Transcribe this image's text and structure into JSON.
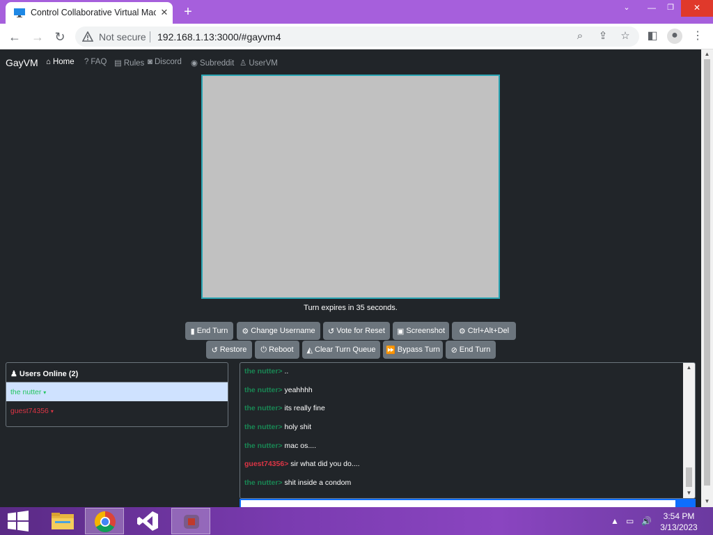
{
  "browser": {
    "tab_title": "Control Collaborative Virtual Mac",
    "not_secure": "Not secure",
    "url": "192.168.1.13:3000/#gayvm4"
  },
  "site": {
    "brand": "GayVM",
    "nav": [
      "Home",
      "FAQ",
      "Rules",
      "Discord",
      "Subreddit",
      "UserVM"
    ]
  },
  "turn_text": "Turn expires in 35 seconds.",
  "buttons_row1": [
    "End Turn",
    "Change Username",
    "Vote for Reset",
    "Screenshot",
    "Ctrl+Alt+Del"
  ],
  "buttons_row2": [
    "Restore",
    "Reboot",
    "Clear Turn Queue",
    "Bypass Turn",
    "End Turn"
  ],
  "users": {
    "header": "Users Online (2)",
    "list": [
      {
        "name": "the nutter",
        "color": "#22c55e",
        "selected": true
      },
      {
        "name": "guest74356",
        "color": "#dc3545",
        "selected": false
      }
    ]
  },
  "chat": [
    {
      "user": "the nutter",
      "text": ".."
    },
    {
      "user": "the nutter",
      "text": "yeahhhh"
    },
    {
      "user": "the nutter",
      "text": "its really fine"
    },
    {
      "user": "the nutter",
      "text": "holy shit"
    },
    {
      "user": "the nutter",
      "text": "mac os...."
    },
    {
      "user": "guest74356",
      "text": "sir what did you do....",
      "guest": true
    },
    {
      "user": "the nutter",
      "text": "shit inside a condom"
    }
  ],
  "clock": {
    "time": "3:54 PM",
    "date": "3/13/2023"
  },
  "colors": {
    "titlebar": "#a65fdc",
    "vm_border": "#2aa5b4",
    "button": "#6c757d",
    "page_bg": "#212529"
  }
}
